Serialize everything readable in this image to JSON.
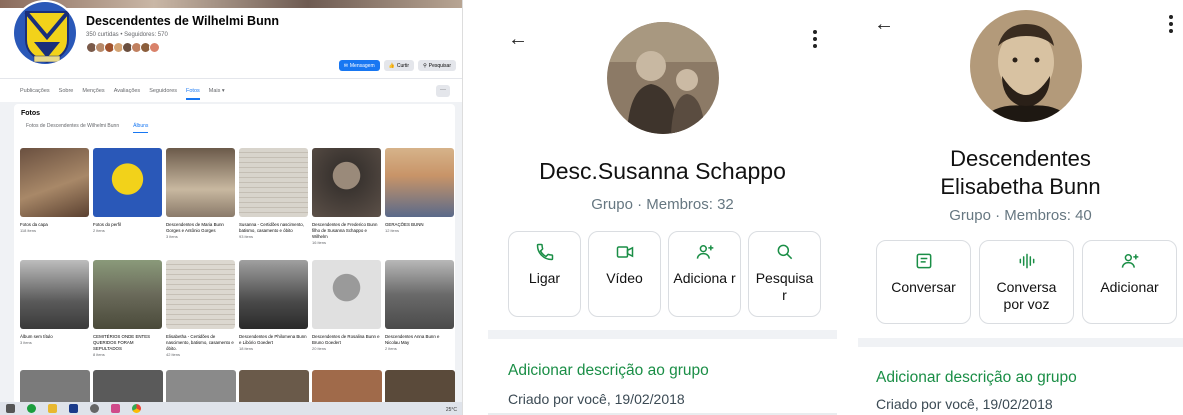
{
  "facebook": {
    "page_title": "Descendentes de Wilhelmi Bunn",
    "page_subtitle": "350 curtidas • Seguidores: 570",
    "buttons": {
      "message": "Mensagem",
      "like": "Curtir",
      "search": "Pesquisar"
    },
    "nav": [
      "Publicações",
      "Sobre",
      "Menções",
      "Avaliações",
      "Seguidores",
      "Fotos",
      "Mais ▾"
    ],
    "nav_more": "···",
    "photos_heading": "Fotos",
    "photo_tabs": [
      "Fotos de Descendentes de Wilhelmi Bunn",
      "Álbuns"
    ],
    "albums": [
      {
        "title": "Fotos da capa",
        "count": "118 itens"
      },
      {
        "title": "Fotos do perfil",
        "count": "2 itens"
      },
      {
        "title": "Descendentes de Maria Bunn Gorges e Antônio Gorges",
        "count": "3 itens"
      },
      {
        "title": "Susanna - Certidões nascimento, batismo, casamento e óbito",
        "count": "93 itens"
      },
      {
        "title": "Descendentes de Frederico Bunn filho de Susanna Schappo e Wilhelm",
        "count": "16 itens"
      },
      {
        "title": "GERAÇÕES BUNN",
        "count": "12 itens"
      },
      {
        "title": "Álbum sem título",
        "count": "3 itens"
      },
      {
        "title": "CEMITÉRIOS ONDE ENTES QUERIDOS FORAM SEPULTADOS",
        "count": "8 itens"
      },
      {
        "title": "Elisabetha - Certidões de nascimento, batismo, casamento e óbito.",
        "count": "42 itens"
      },
      {
        "title": "Descendentes de Philomena Bunn e Libório Goedert",
        "count": "18 itens"
      },
      {
        "title": "Descendentes de Rosalina Bunn e Bruno Goedert",
        "count": "20 itens"
      },
      {
        "title": "Descendentes Anna Bunn e Nicolau May",
        "count": "2 itens"
      }
    ],
    "taskbar_temp": "25°C"
  },
  "group1": {
    "name": "Desc.Susanna Schappo",
    "meta": "Grupo · Membros: 32",
    "actions": [
      {
        "label": "Ligar",
        "icon": "phone-icon"
      },
      {
        "label": "Vídeo",
        "icon": "video-icon"
      },
      {
        "label": "Adiciona r",
        "icon": "add-person-icon"
      },
      {
        "label": "Pesquisa r",
        "icon": "search-icon"
      }
    ],
    "add_description": "Adicionar descrição ao grupo",
    "created": "Criado por você, 19/02/2018"
  },
  "group2": {
    "name": "Descendentes Elisabetha Bunn",
    "meta": "Grupo · Membros: 40",
    "actions": [
      {
        "label": "Conversar",
        "icon": "chat-icon"
      },
      {
        "label": "Conversa por voz",
        "icon": "voice-icon"
      },
      {
        "label": "Adicionar",
        "icon": "add-person-icon"
      }
    ],
    "add_description": "Adicionar descrição ao grupo",
    "created": "Criado por você, 19/02/2018"
  },
  "colors": {
    "whatsapp_green": "#1a8e46",
    "facebook_blue": "#1877f2"
  }
}
